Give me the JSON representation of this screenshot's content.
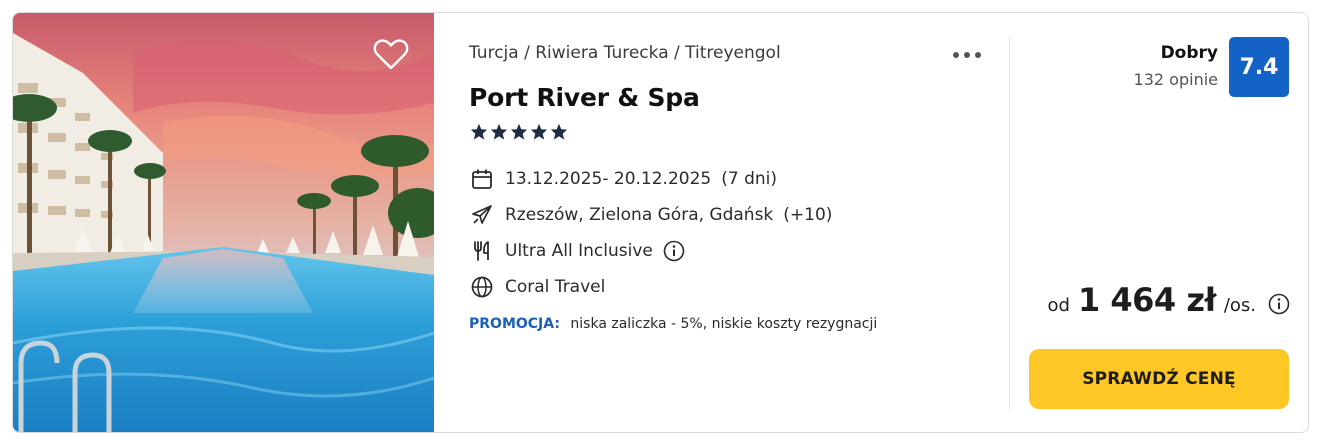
{
  "offer": {
    "breadcrumb": "Turcja / Riwiera Turecka / Titreyengol",
    "hotel_name": "Port River & Spa",
    "stars": 5,
    "dates": "13.12.2025- 20.12.2025",
    "duration": "(7 dni)",
    "departure": "Rzeszów, Zielona Góra, Gdańsk",
    "departure_more": "(+10)",
    "board": "Ultra All Inclusive",
    "operator": "Coral Travel",
    "promo_label": "PROMOCJA:",
    "promo_text": "niska zaliczka - 5%, niskie koszty rezygnacji"
  },
  "rating": {
    "label": "Dobry",
    "reviews": "132 opinie",
    "score": "7.4"
  },
  "price": {
    "prefix": "od",
    "amount": "1 464 zł",
    "suffix": "/os."
  },
  "cta_label": "SPRAWDŹ CENĘ",
  "colors": {
    "accent_blue": "#1562c6",
    "promo_blue": "#1b5fb8",
    "cta_yellow": "#fdc726"
  },
  "icons": {
    "favorite": "heart-icon",
    "more": "more-dots-icon",
    "dates": "calendar-icon",
    "departure": "plane-icon",
    "board": "cutlery-icon",
    "operator": "globe-icon",
    "info": "info-icon"
  }
}
